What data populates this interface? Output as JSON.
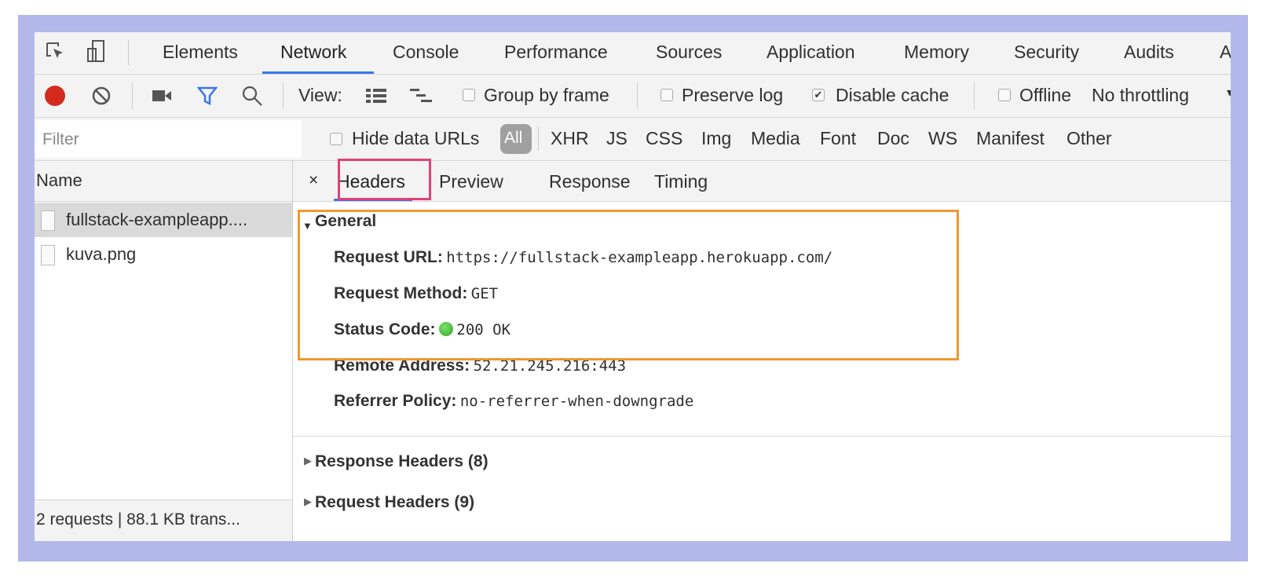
{
  "main_tabs": [
    "Elements",
    "Network",
    "Console",
    "Performance",
    "Sources",
    "Application",
    "Memory",
    "Security",
    "Audits",
    "A"
  ],
  "active_tab": "Network",
  "toolbar": {
    "view_label": "View:",
    "group_by_frame": "Group by frame",
    "preserve_log": "Preserve log",
    "disable_cache": "Disable cache",
    "disable_cache_checked": true,
    "offline": "Offline",
    "throttling": "No throttling"
  },
  "filter": {
    "placeholder": "Filter",
    "hide_data_urls": "Hide data URLs",
    "types": [
      "All",
      "XHR",
      "JS",
      "CSS",
      "Img",
      "Media",
      "Font",
      "Doc",
      "WS",
      "Manifest",
      "Other"
    ],
    "active_type": "All"
  },
  "requests": {
    "header": "Name",
    "items": [
      "fullstack-exampleapp....",
      "kuva.png"
    ],
    "selected": 0,
    "summary": "2 requests | 88.1 KB trans..."
  },
  "detail_tabs": {
    "close": "×",
    "items": [
      "Headers",
      "Preview",
      "Response",
      "Timing"
    ],
    "active": "Headers"
  },
  "general": {
    "title": "General",
    "rows": [
      {
        "label": "Request URL:",
        "value": "https://fullstack-exampleapp.herokuapp.com/"
      },
      {
        "label": "Request Method:",
        "value": "GET"
      },
      {
        "label": "Status Code:",
        "value": "200 OK"
      },
      {
        "label": "Remote Address:",
        "value": "52.21.245.216:443"
      },
      {
        "label": "Referrer Policy:",
        "value": "no-referrer-when-downgrade"
      }
    ]
  },
  "sections": [
    "Response Headers (8)",
    "Request Headers (9)"
  ],
  "colors": {
    "frame": "#b3b8ea",
    "highlight_headers": "#e0407a",
    "highlight_general": "#f0982e",
    "record": "#d32b1e",
    "status_ok": "#3cb531",
    "accent": "#3b78e7"
  }
}
